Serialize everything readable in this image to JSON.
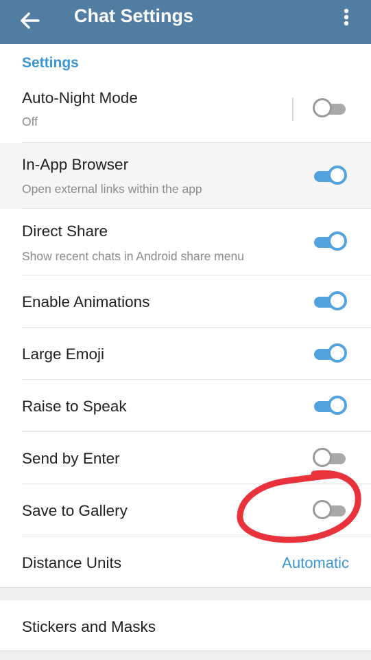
{
  "appbar": {
    "title": "Chat Settings",
    "back_icon": "arrow-left-icon",
    "menu_icon": "more-vert-icon",
    "color": "#527da3"
  },
  "section": {
    "header": "Settings",
    "color": "#3a95d5"
  },
  "rows": [
    {
      "label": "Auto-Night Mode",
      "sub": "Off",
      "toggle": false
    },
    {
      "label": "In-App Browser",
      "sub": "Open external links within the app",
      "toggle": true
    },
    {
      "label": "Direct Share",
      "sub": "Show recent chats in Android share menu",
      "toggle": true
    },
    {
      "label": "Enable Animations",
      "toggle": true
    },
    {
      "label": "Large Emoji",
      "toggle": true
    },
    {
      "label": "Raise to Speak",
      "toggle": true
    },
    {
      "label": "Send by Enter",
      "toggle": false
    },
    {
      "label": "Save to Gallery",
      "toggle": false
    },
    {
      "label": "Distance Units",
      "value": "Automatic"
    }
  ],
  "bottom_row": {
    "label": "Stickers and Masks"
  },
  "colors": {
    "toggle_on": "#52a2de",
    "toggle_off": "#a9a9a9",
    "annotation": "#e8323c"
  }
}
